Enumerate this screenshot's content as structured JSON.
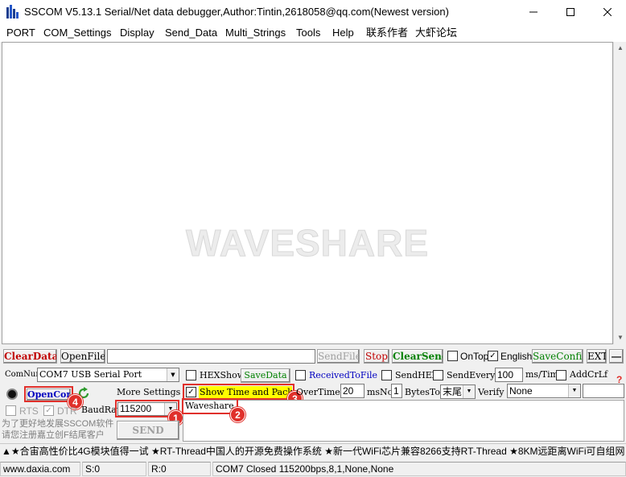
{
  "window": {
    "title": "SSCOM V5.13.1 Serial/Net data debugger,Author:Tintin,2618058@qq.com(Newest version)",
    "icon": "sscom-app-icon"
  },
  "menu": [
    "PORT",
    "COM_Settings",
    "Display",
    "Send_Data",
    "Multi_Strings",
    "Tools",
    "Help",
    "联系作者",
    "大虾论坛"
  ],
  "receive": {
    "watermark": "WAVESHARE"
  },
  "toolbar": {
    "clear_data": "ClearData",
    "open_file": "OpenFile",
    "file_path": "",
    "send_file": "SendFile",
    "stop": "Stop",
    "clear_send": "ClearSend",
    "on_top": "OnTop",
    "on_top_checked": false,
    "english": "English",
    "english_checked": true,
    "save_config": "SaveConfig",
    "ext": "EXT",
    "collapse": "—"
  },
  "port": {
    "com_num_label": "ComNum",
    "com_port": "COM7 USB Serial Port",
    "open_com": "OpenCom",
    "more_settings": "More Settings",
    "rts": "RTS",
    "dtr": "DTR",
    "baud_label": "BaudRat",
    "baud_rate": "115200",
    "send": "SEND",
    "promo": "为了更好地发展SSCOM软件\n请您注册嘉立创F结尾客户"
  },
  "options": {
    "hex_show": "HEXShow",
    "save_data": "SaveData",
    "received_to_file": "ReceivedToFile",
    "send_hex": "SendHEX",
    "send_every": "SendEvery:",
    "send_every_value": "100",
    "send_every_unit": "ms/Tim",
    "add_crlf": "AddCrLf",
    "show_time": "Show Time and Packe",
    "show_time_checked": true,
    "overtime_label": "OverTime:",
    "overtime_value": "20",
    "overtime_unit": "ms",
    "no_label": "No",
    "no_value": "1",
    "bytes_to_label": "BytesTo",
    "bytes_to_value": "末尾",
    "verify_label": "Verify",
    "verify_value": "None"
  },
  "send_text": "Waveshare",
  "badges": [
    "1",
    "2",
    "3",
    "4"
  ],
  "marquee": "▲★合宙高性价比4G模块值得一试 ★RT-Thread中国人的开源免费操作系统 ★新一代WiFi芯片兼容8266支持RT-Thread ★8KM远距离WiFi可自组网",
  "status": {
    "website": "www.daxia.com",
    "sent": "S:0",
    "received": "R:0",
    "port_state": "COM7 Closed  115200bps,8,1,None,None"
  },
  "colors": {
    "accent_red": "#e0302b",
    "highlight_yellow": "#ffff00",
    "button_red_text": "#c00000",
    "button_green_text": "#008000",
    "button_blue_text": "#0000c0"
  }
}
